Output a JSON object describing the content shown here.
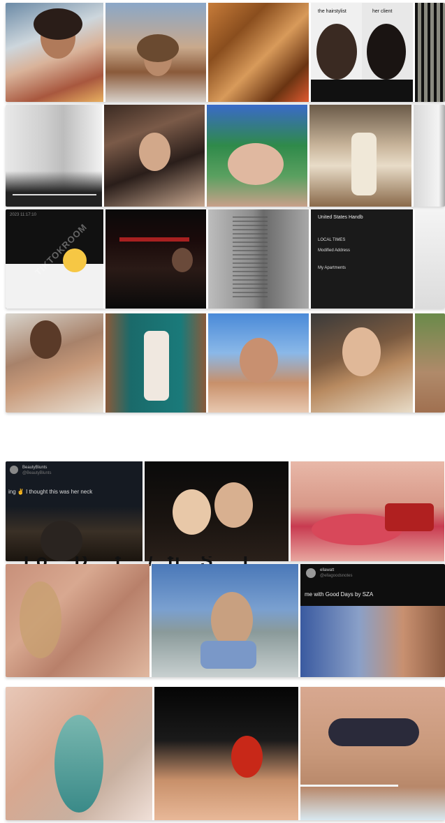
{
  "collage": {
    "row1": {
      "captions": [
        "the hairstylist",
        "her client"
      ]
    },
    "row3": {
      "watermark": "TIKTOKROOM",
      "document_title": "United States Handb",
      "document_lines": [
        "LOCAL TIMES",
        "Modified Address",
        "My Apartments"
      ],
      "note_text": "2023 11:17:10",
      "emoji": "😶"
    },
    "row5": {
      "tweet_user": "BeautyBlunts",
      "tweet_handle": "@BeautyBlunts",
      "tweet_text": "ing ✌ I thought this was her neck"
    },
    "row6": {
      "tweet_user": "ellawatt",
      "tweet_handle": "@ellagoodsnotes",
      "tweet_text": "me with Good Days by SZA"
    },
    "overlay_text": "Lo... D... f... /..fi...S... T..."
  }
}
